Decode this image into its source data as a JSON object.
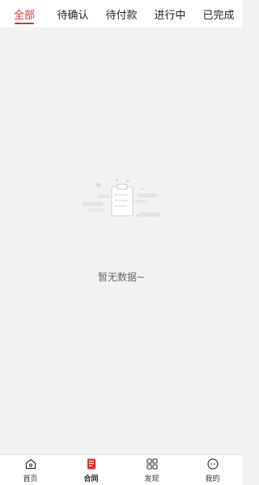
{
  "tabs": [
    {
      "label": "全部",
      "active": true
    },
    {
      "label": "待确认",
      "active": false
    },
    {
      "label": "待付款",
      "active": false
    },
    {
      "label": "进行中",
      "active": false
    },
    {
      "label": "已完成",
      "active": false
    }
  ],
  "empty_state": {
    "icon": "clipboard-icon",
    "text": "暂无数据~"
  },
  "bottom_nav": [
    {
      "label": "首页",
      "icon": "home-icon",
      "active": false
    },
    {
      "label": "合同",
      "icon": "contract-icon",
      "active": true
    },
    {
      "label": "发现",
      "icon": "grid-icon",
      "active": false
    },
    {
      "label": "我的",
      "icon": "profile-icon",
      "active": false
    }
  ],
  "colors": {
    "accent": "#d8312c",
    "background": "#f2f2f2",
    "surface": "#ffffff"
  }
}
